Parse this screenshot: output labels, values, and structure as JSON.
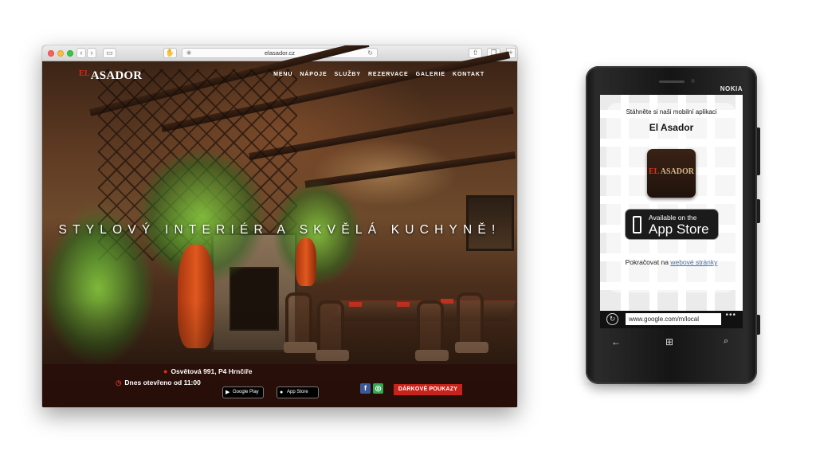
{
  "browser": {
    "url": "elasador.cz"
  },
  "site": {
    "logo_main": "ASADOR",
    "logo_prefix": "EL",
    "nav": [
      "MENU",
      "NÁPOJE",
      "SLUŽBY",
      "REZERVACE",
      "GALERIE",
      "KONTAKT"
    ],
    "tagline": "STYLOVÝ INTERIÉR A SKVĚLÁ KUCHYNĚ!",
    "address": "Osvětová 991, P4 Hrnčíře",
    "hours": "Dnes otevřeno od 11:00",
    "google_play_label": "Google Play",
    "app_store_label": "App Store",
    "gift_button": "DÁRKOVÉ POUKAZY",
    "social": [
      "facebook-icon",
      "tripadvisor-icon"
    ]
  },
  "phone": {
    "brand": "NOKIA",
    "prompt": "Stáhněte si naši mobilní aplikaci",
    "app_name": "El Asador",
    "icon_text": "ASADOR",
    "icon_prefix": "EL",
    "store_line1": "Available on the",
    "store_line2": "App Store",
    "continue_text": "Pokračovat na",
    "continue_link": "webové stránky",
    "url": "www.google.com/m/local",
    "more": "•••"
  },
  "colors": {
    "accent_red": "#c8231b",
    "link_blue": "#4a6fa5"
  }
}
